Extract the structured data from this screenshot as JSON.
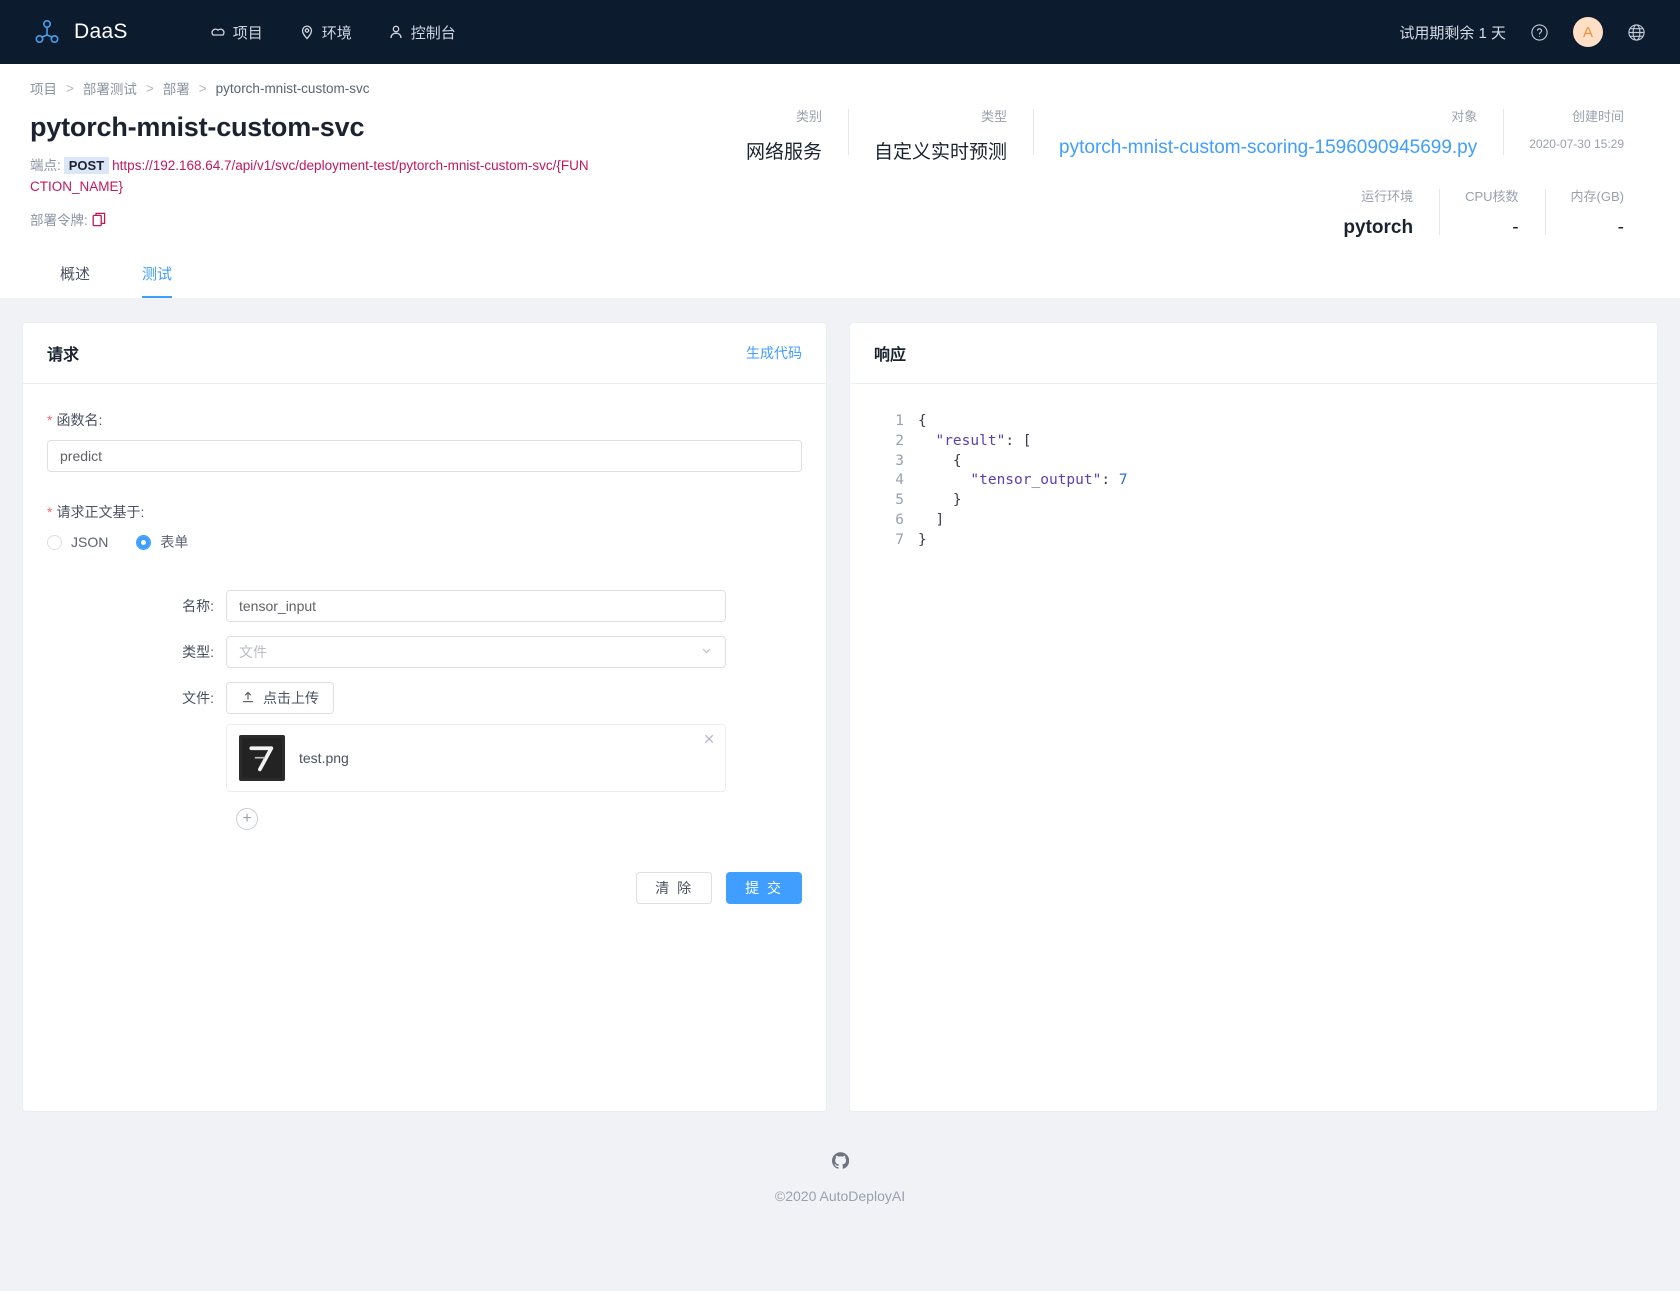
{
  "topnav": {
    "brand": "DaaS",
    "links": [
      {
        "label": "项目",
        "icon": "cloud-icon"
      },
      {
        "label": "环境",
        "icon": "location-pin-icon"
      },
      {
        "label": "控制台",
        "icon": "user-icon"
      }
    ],
    "trial": "试用期剩余 1 天",
    "help_icon": "question-circle-icon",
    "avatar_initial": "A",
    "language_icon": "globe-icon"
  },
  "breadcrumb": {
    "items": [
      "项目",
      "部署测试",
      "部署",
      "pytorch-mnist-custom-svc"
    ],
    "separator": ">"
  },
  "header": {
    "title": "pytorch-mnist-custom-svc",
    "endpoint_label": "端点:",
    "method": "POST",
    "url": "https://192.168.64.7/api/v1/svc/deployment-test/pytorch-mnist-custom-svc/{FUNCTION_NAME}",
    "token_label": "部署令牌:",
    "copy_icon": "copy-icon",
    "meta_row1": [
      {
        "label": "类别",
        "value": "网络服务",
        "style": "plain"
      },
      {
        "label": "类型",
        "value": "自定义实时预测",
        "style": "plain"
      },
      {
        "label": "对象",
        "value": "pytorch-mnist-custom-scoring-1596090945699.py",
        "style": "link"
      },
      {
        "label": "创建时间",
        "value": "2020-07-30 15:29",
        "style": "small"
      }
    ],
    "meta_row2": [
      {
        "label": "运行环境",
        "value": "pytorch",
        "style": "bold"
      },
      {
        "label": "CPU核数",
        "value": "-",
        "style": "plain"
      },
      {
        "label": "内存(GB)",
        "value": "-",
        "style": "plain"
      }
    ]
  },
  "tabs": [
    {
      "label": "概述",
      "active": false
    },
    {
      "label": "测试",
      "active": true
    }
  ],
  "request": {
    "card_title": "请求",
    "generate_code": "生成代码",
    "function_name_label": "函数名:",
    "function_name_value": "predict",
    "function_name_placeholder": "",
    "body_type_label": "请求正文基于:",
    "radios": [
      {
        "label": "JSON",
        "checked": false
      },
      {
        "label": "表单",
        "checked": true
      }
    ],
    "name_label": "名称:",
    "name_value": "tensor_input",
    "type_label": "类型:",
    "type_value": "文件",
    "file_label": "文件:",
    "upload_button": "点击上传",
    "upload_icon": "upload-icon",
    "file_item": {
      "name": "test.png",
      "thumbnail": "mnist-digit-7",
      "remove_icon": "close-icon"
    },
    "add_icon": "plus-circle-icon",
    "clear_button": "清 除",
    "submit_button": "提 交"
  },
  "response": {
    "card_title": "响应",
    "lines": [
      {
        "n": "1",
        "text": "{"
      },
      {
        "n": "2",
        "text": "  \"result\": ["
      },
      {
        "n": "3",
        "text": "    {"
      },
      {
        "n": "4",
        "text": "      \"tensor_output\": 7"
      },
      {
        "n": "5",
        "text": "    }"
      },
      {
        "n": "6",
        "text": "  ]"
      },
      {
        "n": "7",
        "text": "}"
      }
    ],
    "payload": {
      "result": [
        {
          "tensor_output": 7
        }
      ]
    }
  },
  "footer": {
    "github_icon": "github-icon",
    "copyright": "©2020 AutoDeployAI"
  },
  "colors": {
    "nav_bg": "#0d1b2e",
    "accent": "#409eff",
    "url_magenta": "#c2185b",
    "page_bg": "#f0f2f5"
  }
}
